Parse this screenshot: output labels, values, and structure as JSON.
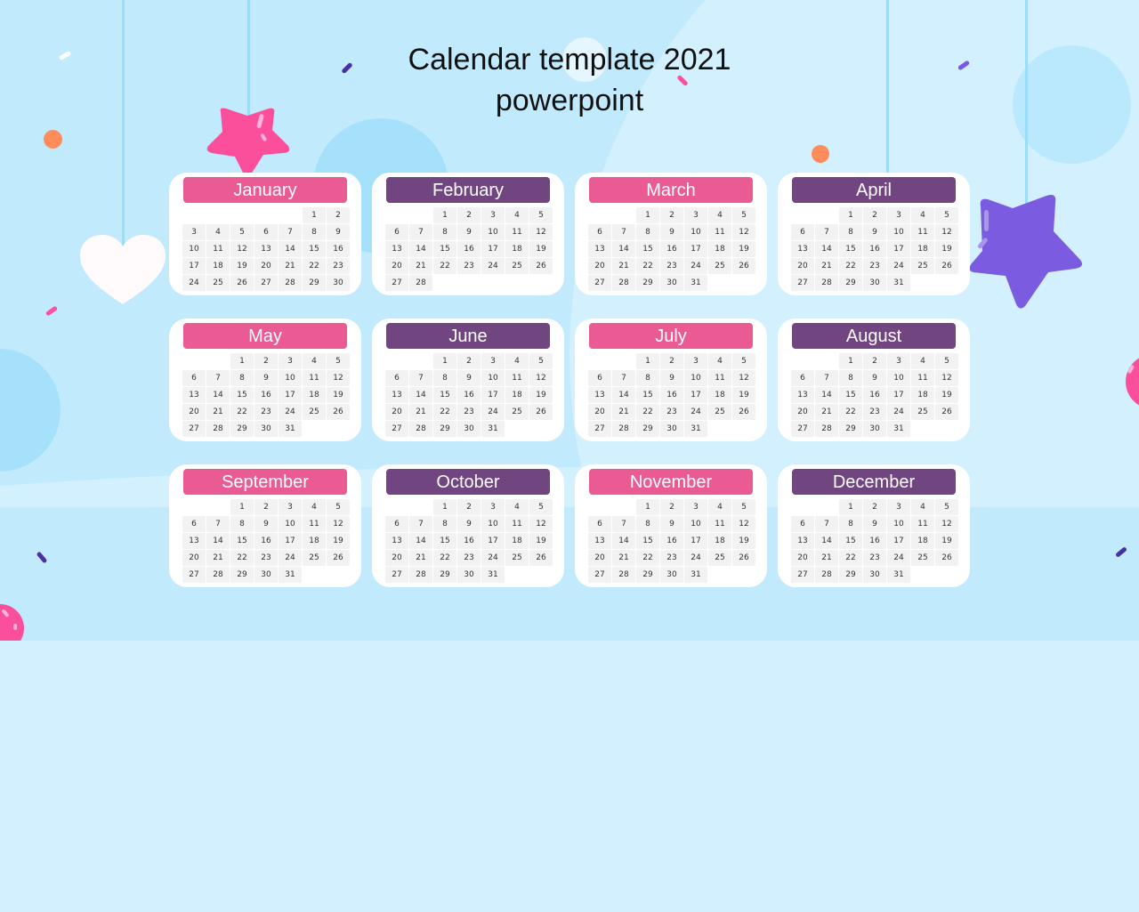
{
  "title": {
    "line1": "Calendar template 2021",
    "line2": "powerpoint"
  },
  "colors": {
    "pink": "#eb5b93",
    "purple": "#714680",
    "background": "#c2eafd",
    "cell": "#f2f2f2"
  },
  "decorations": {
    "hanging": [
      "star-pink",
      "heart-white",
      "star-purple"
    ],
    "balls": [
      "ball-pink-right",
      "ball-pink-bottom-left"
    ]
  },
  "months": [
    {
      "name": "January",
      "color": "pink",
      "offset": 5,
      "days": 30
    },
    {
      "name": "February",
      "color": "purple",
      "offset": 2,
      "days": 28
    },
    {
      "name": "March",
      "color": "pink",
      "offset": 2,
      "days": 31
    },
    {
      "name": "April",
      "color": "purple",
      "offset": 2,
      "days": 31
    },
    {
      "name": "May",
      "color": "pink",
      "offset": 2,
      "days": 31
    },
    {
      "name": "June",
      "color": "purple",
      "offset": 2,
      "days": 31
    },
    {
      "name": "July",
      "color": "pink",
      "offset": 2,
      "days": 31
    },
    {
      "name": "August",
      "color": "purple",
      "offset": 2,
      "days": 31
    },
    {
      "name": "September",
      "color": "pink",
      "offset": 2,
      "days": 31
    },
    {
      "name": "October",
      "color": "purple",
      "offset": 2,
      "days": 31
    },
    {
      "name": "November",
      "color": "pink",
      "offset": 2,
      "days": 31
    },
    {
      "name": "December",
      "color": "purple",
      "offset": 2,
      "days": 31
    }
  ]
}
